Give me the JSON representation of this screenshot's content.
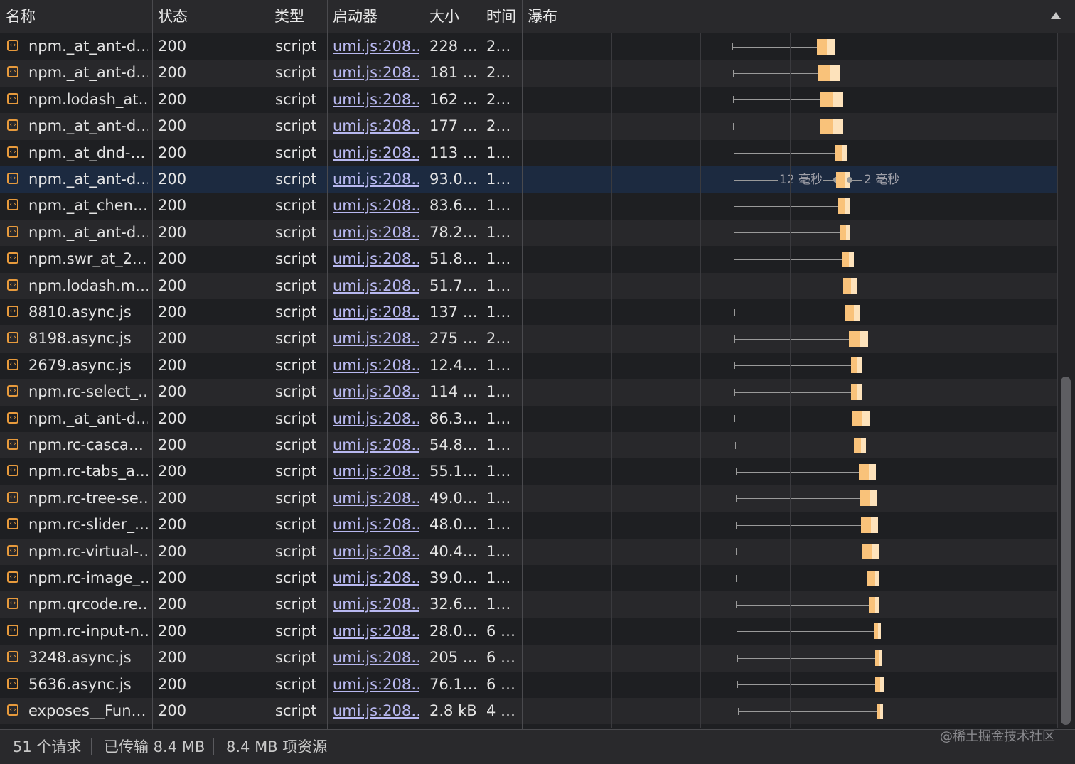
{
  "header": {
    "columns": [
      "名称",
      "状态",
      "类型",
      "启动器",
      "大小",
      "时间",
      "瀑布"
    ]
  },
  "selected_tooltip": {
    "left_label": "12 毫秒",
    "right_label": "2 毫秒"
  },
  "rows": [
    {
      "name": "npm._at_ant-d…",
      "status": "200",
      "type": "script",
      "initiator": "umi.js:208…",
      "size": "228 …",
      "time": "2…"
    },
    {
      "name": "npm._at_ant-d…",
      "status": "200",
      "type": "script",
      "initiator": "umi.js:208…",
      "size": "181 …",
      "time": "2…"
    },
    {
      "name": "npm.lodash_at…",
      "status": "200",
      "type": "script",
      "initiator": "umi.js:208…",
      "size": "162 …",
      "time": "2…"
    },
    {
      "name": "npm._at_ant-d…",
      "status": "200",
      "type": "script",
      "initiator": "umi.js:208…",
      "size": "177 …",
      "time": "2…"
    },
    {
      "name": "npm._at_dnd-…",
      "status": "200",
      "type": "script",
      "initiator": "umi.js:208…",
      "size": "113 …",
      "time": "1…"
    },
    {
      "name": "npm._at_ant-d…",
      "status": "200",
      "type": "script",
      "initiator": "umi.js:208…",
      "size": "93.0…",
      "time": "1…"
    },
    {
      "name": "npm._at_chen…",
      "status": "200",
      "type": "script",
      "initiator": "umi.js:208…",
      "size": "83.6…",
      "time": "1…"
    },
    {
      "name": "npm._at_ant-d…",
      "status": "200",
      "type": "script",
      "initiator": "umi.js:208…",
      "size": "78.2…",
      "time": "1…"
    },
    {
      "name": "npm.swr_at_2.…",
      "status": "200",
      "type": "script",
      "initiator": "umi.js:208…",
      "size": "51.8…",
      "time": "1…"
    },
    {
      "name": "npm.lodash.m…",
      "status": "200",
      "type": "script",
      "initiator": "umi.js:208…",
      "size": "51.7…",
      "time": "1…"
    },
    {
      "name": "8810.async.js",
      "status": "200",
      "type": "script",
      "initiator": "umi.js:208…",
      "size": "137 …",
      "time": "1…"
    },
    {
      "name": "8198.async.js",
      "status": "200",
      "type": "script",
      "initiator": "umi.js:208…",
      "size": "275 …",
      "time": "2…"
    },
    {
      "name": "2679.async.js",
      "status": "200",
      "type": "script",
      "initiator": "umi.js:208…",
      "size": "12.4…",
      "time": "1…"
    },
    {
      "name": "npm.rc-select_…",
      "status": "200",
      "type": "script",
      "initiator": "umi.js:208…",
      "size": "114 …",
      "time": "1…"
    },
    {
      "name": "npm._at_ant-d…",
      "status": "200",
      "type": "script",
      "initiator": "umi.js:208…",
      "size": "86.3…",
      "time": "1…"
    },
    {
      "name": "npm.rc-casca…",
      "status": "200",
      "type": "script",
      "initiator": "umi.js:208…",
      "size": "54.8…",
      "time": "1…"
    },
    {
      "name": "npm.rc-tabs_a…",
      "status": "200",
      "type": "script",
      "initiator": "umi.js:208…",
      "size": "55.1…",
      "time": "1…"
    },
    {
      "name": "npm.rc-tree-se…",
      "status": "200",
      "type": "script",
      "initiator": "umi.js:208…",
      "size": "49.0…",
      "time": "1…"
    },
    {
      "name": "npm.rc-slider_…",
      "status": "200",
      "type": "script",
      "initiator": "umi.js:208…",
      "size": "48.0…",
      "time": "1…"
    },
    {
      "name": "npm.rc-virtual-…",
      "status": "200",
      "type": "script",
      "initiator": "umi.js:208…",
      "size": "40.4…",
      "time": "1…"
    },
    {
      "name": "npm.rc-image_…",
      "status": "200",
      "type": "script",
      "initiator": "umi.js:208…",
      "size": "39.0…",
      "time": "1…"
    },
    {
      "name": "npm.qrcode.re…",
      "status": "200",
      "type": "script",
      "initiator": "umi.js:208…",
      "size": "32.6…",
      "time": "1…"
    },
    {
      "name": "npm.rc-input-n…",
      "status": "200",
      "type": "script",
      "initiator": "umi.js:208…",
      "size": "28.0…",
      "time": "6 …"
    },
    {
      "name": "3248.async.js",
      "status": "200",
      "type": "script",
      "initiator": "umi.js:208…",
      "size": "205 …",
      "time": "6 …"
    },
    {
      "name": "5636.async.js",
      "status": "200",
      "type": "script",
      "initiator": "umi.js:208…",
      "size": "76.1…",
      "time": "6 …"
    },
    {
      "name": "exposes__Fun…",
      "status": "200",
      "type": "script",
      "initiator": "umi.js:208…",
      "size": "2.8 kB",
      "time": "4 …"
    }
  ],
  "footer": {
    "requests": "51 个请求",
    "transferred": "已传输 8.4 MB",
    "resources": "8.4 MB 项资源",
    "watermark": "@稀土掘金技术社区"
  },
  "colors": {
    "waiting": "#f9c27a",
    "receiving": "#fde2bb",
    "initiator_link": "#b8b8f0",
    "selected_row": "#1c2a40"
  }
}
